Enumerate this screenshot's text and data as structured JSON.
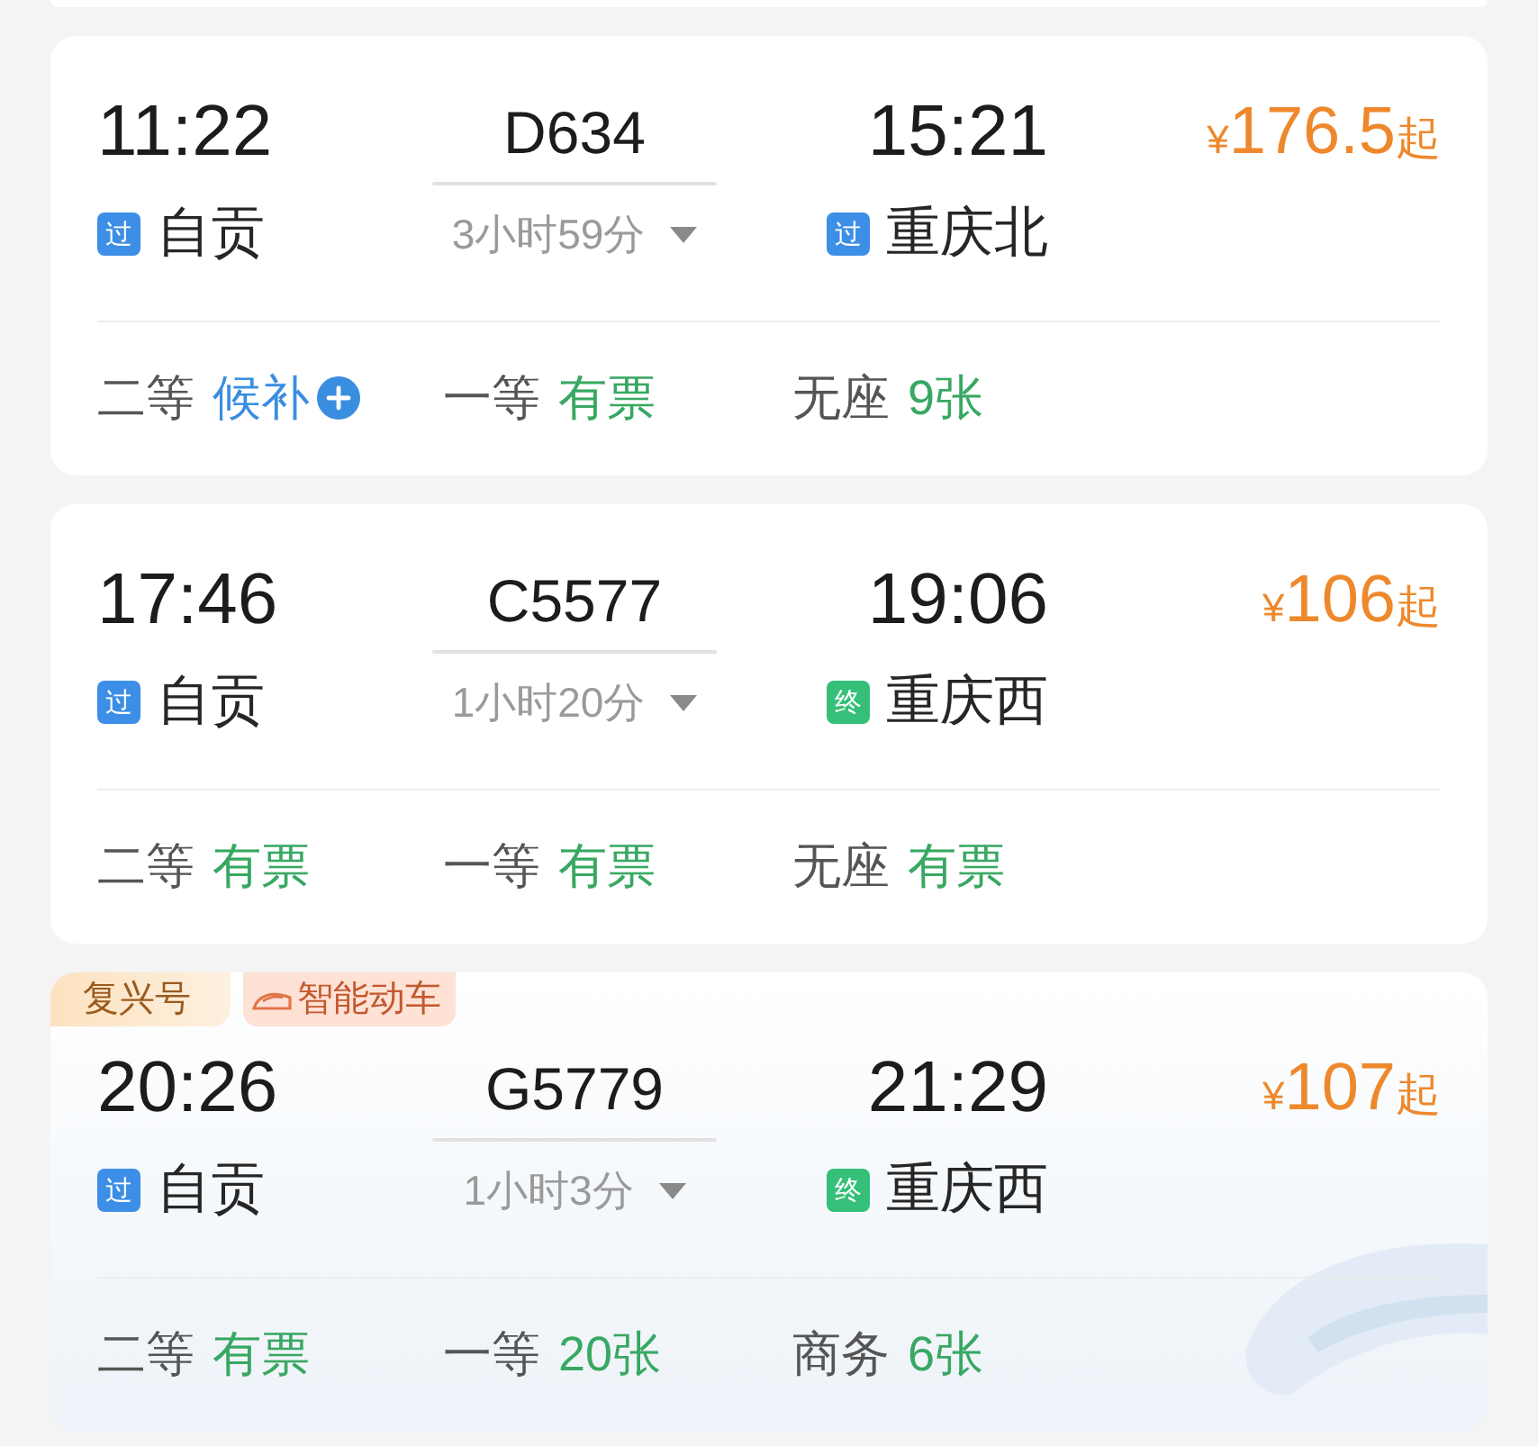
{
  "trains": [
    {
      "kind": "standard",
      "depart": {
        "time": "11:22",
        "badge": {
          "text": "过",
          "kind": "pass"
        },
        "station": "自贡"
      },
      "train_no": "D634",
      "duration": "3小时59分",
      "arrive": {
        "time": "15:21",
        "badge": {
          "text": "过",
          "kind": "pass"
        },
        "station": "重庆北"
      },
      "price": {
        "currency": "¥",
        "amount": "176.5",
        "suffix": "起"
      },
      "seats": [
        {
          "class": "二等",
          "status": "候补",
          "kind": "waitlist"
        },
        {
          "class": "一等",
          "status": "有票",
          "kind": "available"
        },
        {
          "class": "无座",
          "status": "9张",
          "kind": "available"
        }
      ]
    },
    {
      "kind": "standard",
      "depart": {
        "time": "17:46",
        "badge": {
          "text": "过",
          "kind": "pass"
        },
        "station": "自贡"
      },
      "train_no": "C5577",
      "duration": "1小时20分",
      "arrive": {
        "time": "19:06",
        "badge": {
          "text": "终",
          "kind": "terminal"
        },
        "station": "重庆西"
      },
      "price": {
        "currency": "¥",
        "amount": "106",
        "suffix": "起"
      },
      "seats": [
        {
          "class": "二等",
          "status": "有票",
          "kind": "available"
        },
        {
          "class": "一等",
          "status": "有票",
          "kind": "available"
        },
        {
          "class": "无座",
          "status": "有票",
          "kind": "available"
        }
      ]
    },
    {
      "kind": "featured",
      "tags": [
        {
          "label": "复兴号",
          "kind": "plain"
        },
        {
          "label": "智能动车",
          "kind": "smart"
        }
      ],
      "depart": {
        "time": "20:26",
        "badge": {
          "text": "过",
          "kind": "pass"
        },
        "station": "自贡"
      },
      "train_no": "G5779",
      "duration": "1小时3分",
      "arrive": {
        "time": "21:29",
        "badge": {
          "text": "终",
          "kind": "terminal"
        },
        "station": "重庆西"
      },
      "price": {
        "currency": "¥",
        "amount": "107",
        "suffix": "起"
      },
      "seats": [
        {
          "class": "二等",
          "status": "有票",
          "kind": "available"
        },
        {
          "class": "一等",
          "status": "20张",
          "kind": "available"
        },
        {
          "class": "商务",
          "status": "6张",
          "kind": "available"
        }
      ]
    }
  ]
}
